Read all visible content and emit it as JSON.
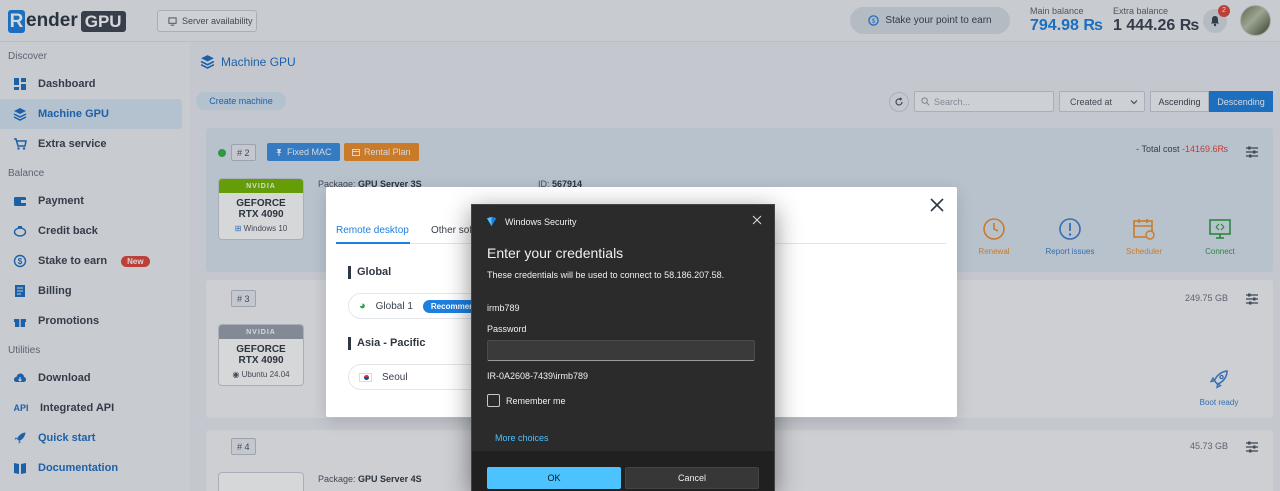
{
  "header": {
    "logo_r": "R",
    "logo_ender": "ender",
    "logo_gpu": "GPU",
    "server_availability": "Server availability",
    "stake_label": "Stake your point to earn",
    "main_balance_label": "Main balance",
    "main_balance_value": "794.98 ₨",
    "extra_balance_label": "Extra balance",
    "extra_balance_value": "1 444.26 ₨",
    "notification_count": "2"
  },
  "sidebar": {
    "discover_title": "Discover",
    "balance_title": "Balance",
    "utilities_title": "Utilities",
    "items": {
      "dashboard": "Dashboard",
      "machine_gpu": "Machine GPU",
      "extra_service": "Extra service",
      "payment": "Payment",
      "credit_back": "Credit back",
      "stake_to_earn": "Stake to earn",
      "new_badge": "New",
      "billing": "Billing",
      "promotions": "Promotions",
      "download": "Download",
      "integrated_api": "Integrated API",
      "api_glyph": "API",
      "quick_start": "Quick start",
      "documentation": "Documentation"
    }
  },
  "main": {
    "title": "Machine GPU",
    "create_machine": "Create machine",
    "search_placeholder": "Search...",
    "sort_field": "Created at",
    "ascending": "Ascending",
    "descending": "Descending",
    "cards": [
      {
        "num": "# 2",
        "fixed_mac": "Fixed MAC",
        "rental_plan": "Rental Plan",
        "total_cost_label": "- Total cost",
        "total_cost_value": "-14169.6₨",
        "package_label": "Package:",
        "package_value": "GPU Server 3S",
        "id_label": "ID:",
        "id_value": "567914",
        "gpu_brand": "NVIDIA",
        "gpu_line1": "GEFORCE",
        "gpu_line2": "RTX 4090",
        "os": "Windows 10",
        "actions": {
          "renewal": "Renewal",
          "report_issues": "Report issues",
          "scheduler": "Scheduler",
          "connect": "Connect"
        }
      },
      {
        "num": "# 3",
        "storage": "249.75 GB",
        "gpu_brand": "NVIDIA",
        "gpu_line1": "GEFORCE",
        "gpu_line2": "RTX 4090",
        "os": "Ubuntu 24.04",
        "boot_ready": "Boot ready"
      },
      {
        "num": "# 4",
        "storage": "45.73 GB",
        "package_label": "Package:",
        "package_value": "GPU Server 4S"
      }
    ]
  },
  "modal": {
    "tab_remote": "Remote desktop",
    "tab_other": "Other sof",
    "region_global": "Global",
    "server_global": "Global 1",
    "recommended": "Recommen",
    "region_asia": "Asia - Pacific",
    "server_seoul": "Seoul"
  },
  "win_dialog": {
    "title": "Windows Security",
    "heading": "Enter your credentials",
    "subtitle": "These credentials will be used to connect to 58.186.207.58.",
    "username": "irmb789",
    "password_label": "Password",
    "password_value": "",
    "domain_user": "IR-0A2608-7439\\irmb789",
    "remember_me": "Remember me",
    "more_choices": "More choices",
    "ok": "OK",
    "cancel": "Cancel"
  },
  "colors": {
    "accent": "#1d7fe0",
    "win_accent": "#4cc2ff",
    "danger": "#e0463c",
    "warning": "#f08f2a"
  }
}
